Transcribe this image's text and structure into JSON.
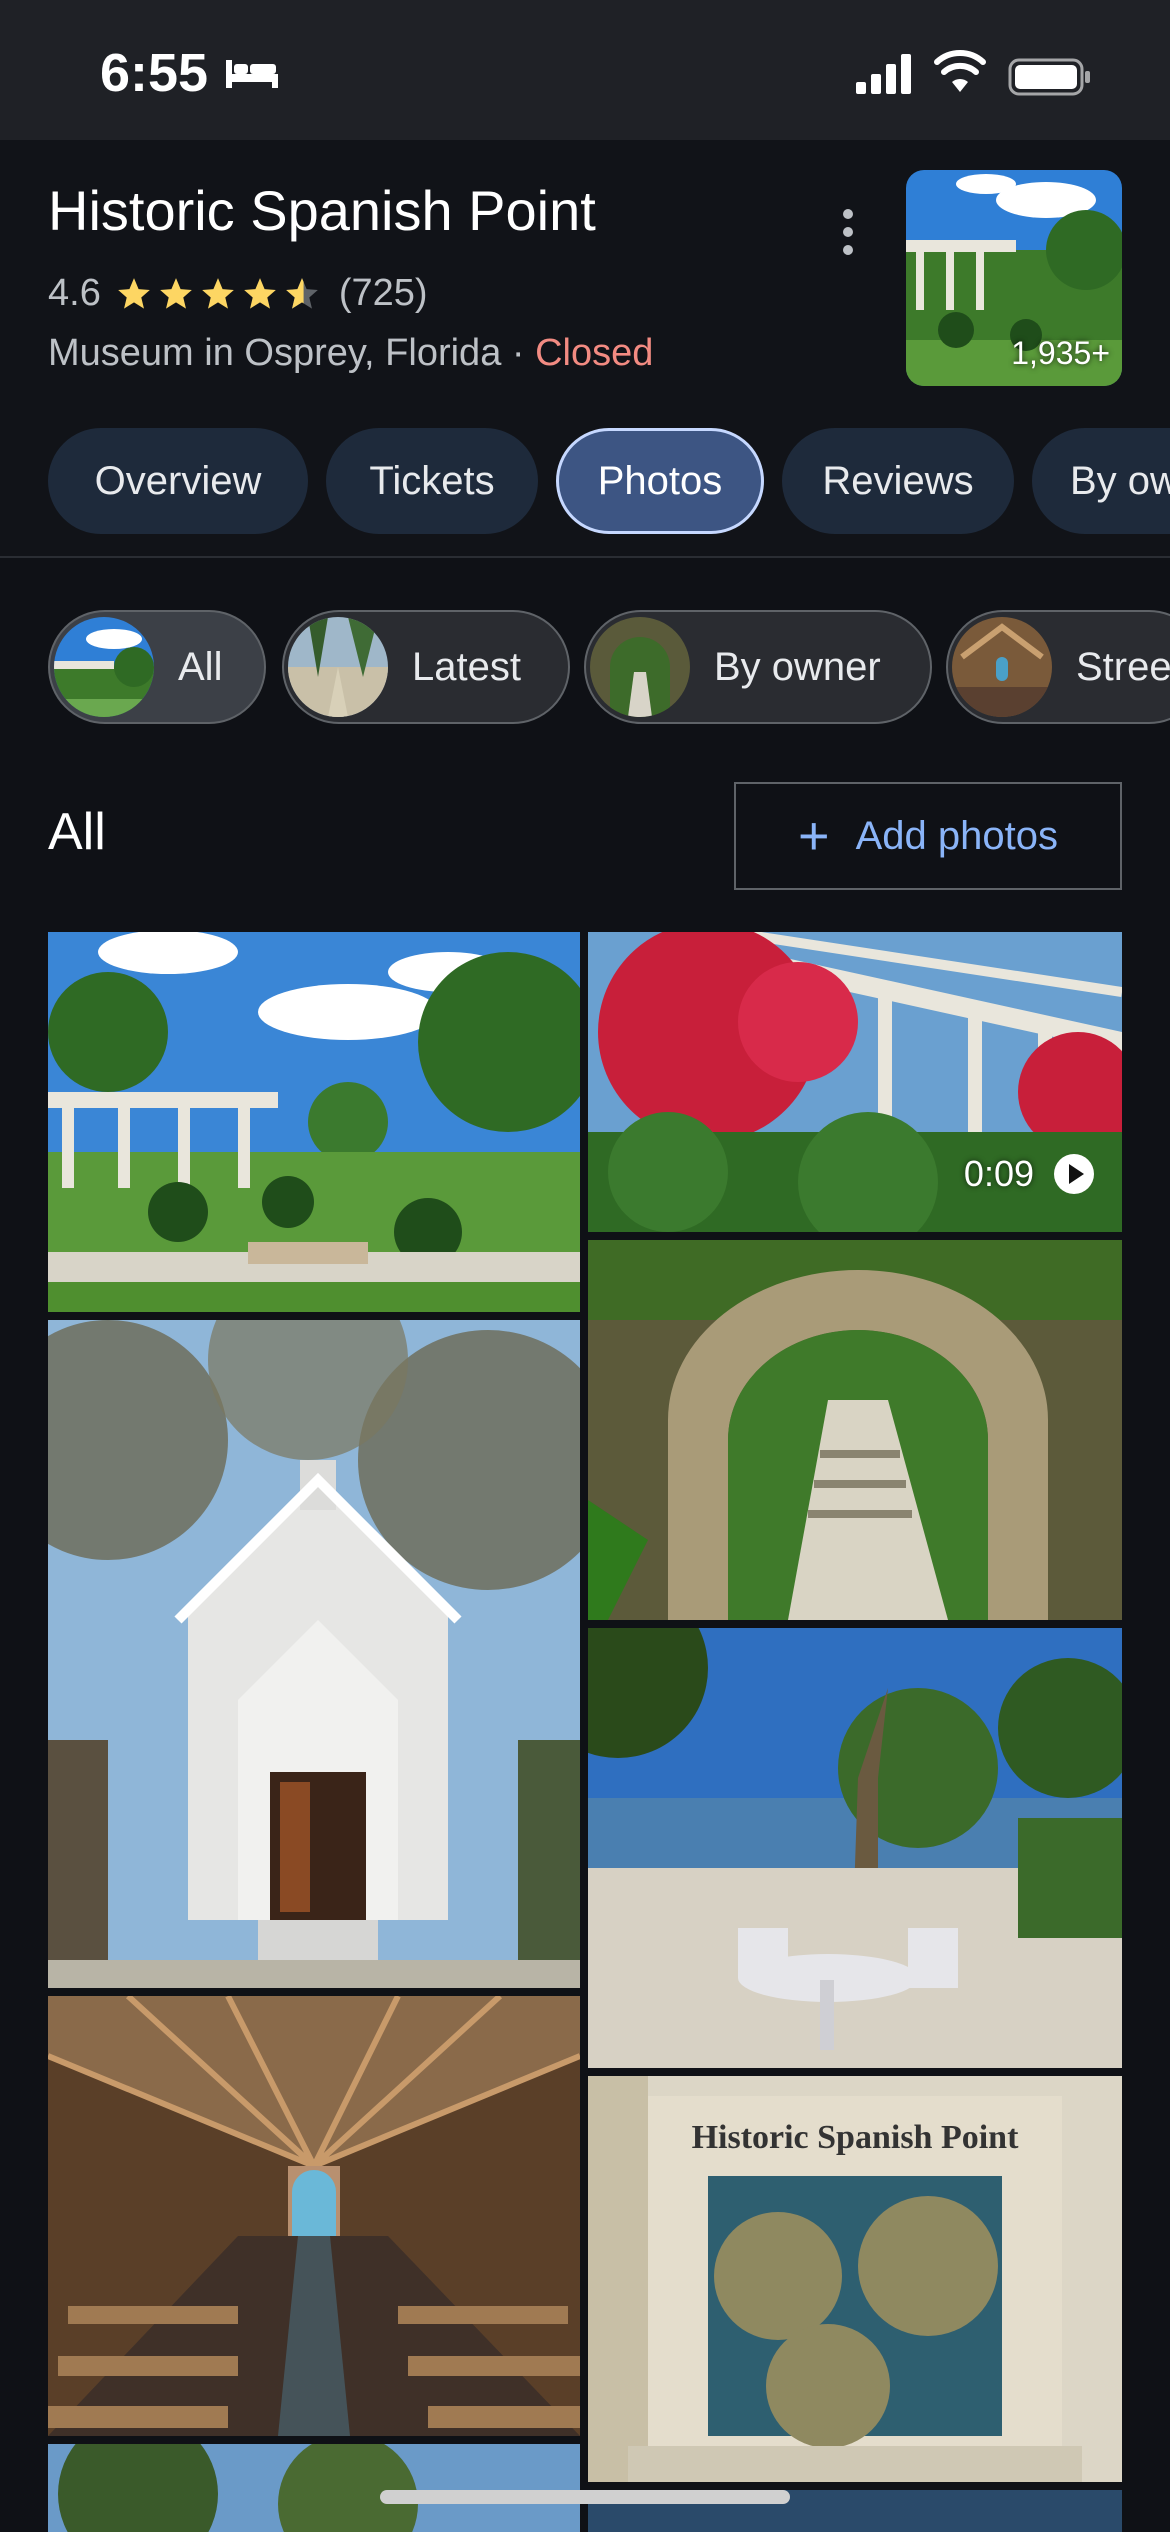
{
  "status": {
    "time": "6:55"
  },
  "place": {
    "title": "Historic Spanish Point",
    "rating": "4.6",
    "stars": 4.6,
    "review_count": "(725)",
    "category": "Museum in Osprey, Florida",
    "separator": "·",
    "status": "Closed",
    "photo_count": "1,935+"
  },
  "tabs": [
    {
      "label": "Overview"
    },
    {
      "label": "Tickets"
    },
    {
      "label": "Photos"
    },
    {
      "label": "Reviews"
    },
    {
      "label": "By ow"
    }
  ],
  "chips": [
    {
      "label": "All"
    },
    {
      "label": "Latest"
    },
    {
      "label": "By owner"
    },
    {
      "label": "Stree"
    }
  ],
  "section": {
    "heading": "All",
    "add_label": "Add photos"
  },
  "video": {
    "duration": "0:09"
  },
  "colors": {
    "accent": "#8ab4f8",
    "closed": "#f28b82",
    "star": "#fdd663",
    "tab_active": "#3d5583"
  }
}
